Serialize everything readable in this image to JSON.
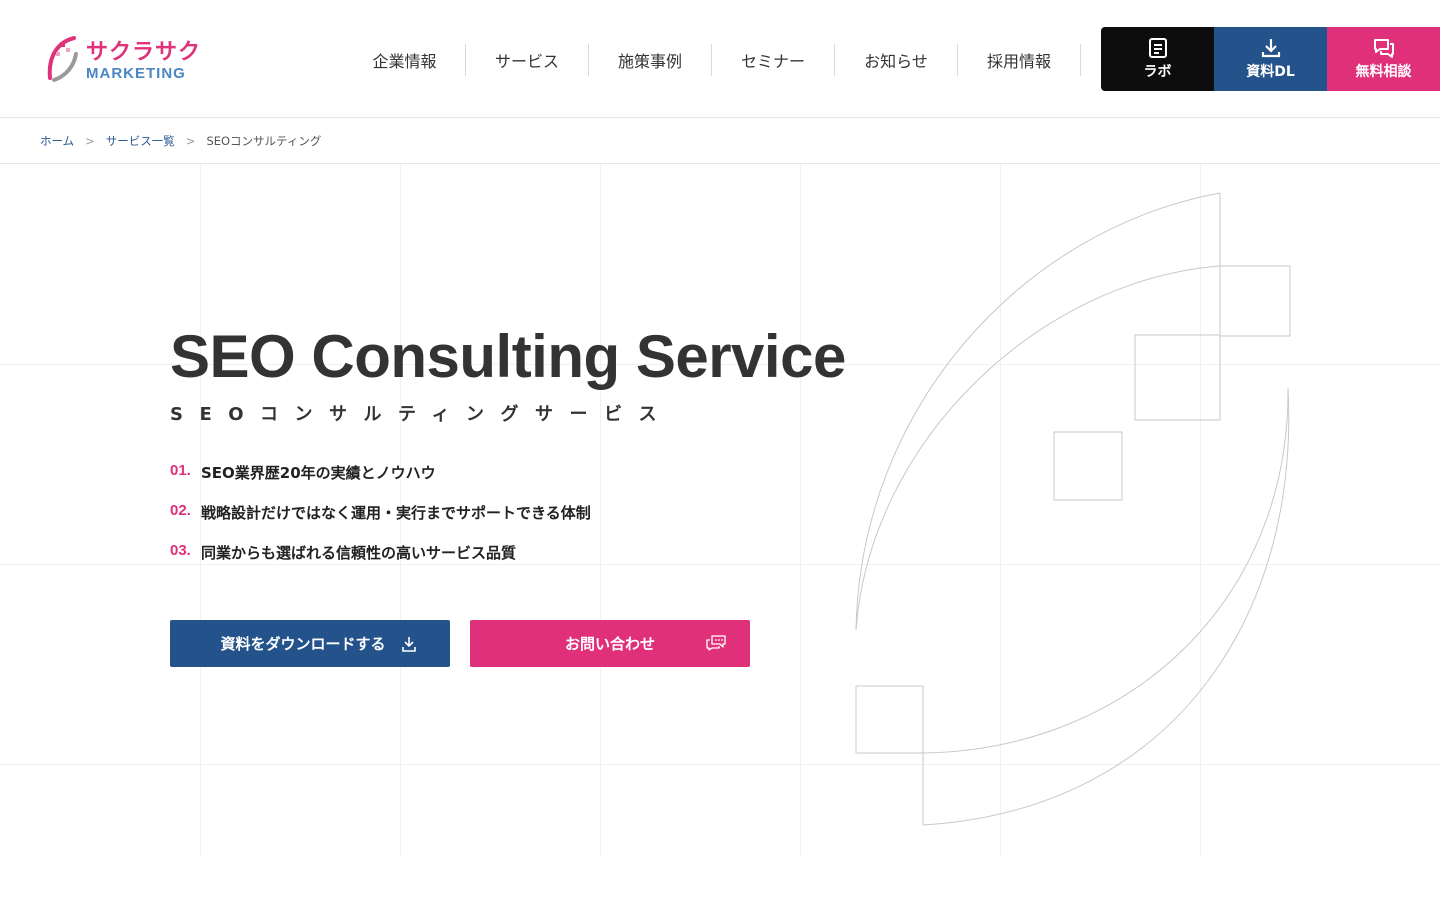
{
  "logo": {
    "jp": "サクラサク",
    "en": "MARKETING",
    "brand_pink": "#e0327a",
    "brand_blue": "#4a87c4"
  },
  "nav": {
    "items": [
      "企業情報",
      "サービス",
      "施策事例",
      "セミナー",
      "お知らせ",
      "採用情報"
    ]
  },
  "header_buttons": {
    "lab": {
      "label": "ラボ",
      "icon": "document-icon",
      "color": "#0d0d0d"
    },
    "download": {
      "label": "資料DL",
      "icon": "download-icon",
      "color": "#24528a"
    },
    "consult": {
      "label": "無料相談",
      "icon": "chat-icon",
      "color": "#e0307a"
    }
  },
  "breadcrumb": {
    "home": "ホーム",
    "sep1": ">",
    "services": "サービス一覧",
    "sep2": ">",
    "current": "SEOコンサルティング"
  },
  "hero": {
    "title": "SEO Consulting Service",
    "subtitle": "SEOコンサルティングサービス",
    "points": [
      {
        "num": "01.",
        "text": "SEO業界歴20年の実績とノウハウ"
      },
      {
        "num": "02.",
        "text": "戦略設計だけではなく運用・実行までサポートできる体制"
      },
      {
        "num": "03.",
        "text": "同業からも選ばれる信頼性の高いサービス品質"
      }
    ],
    "cta_download": {
      "label": "資料をダウンロードする",
      "icon": "download-arrow-icon"
    },
    "cta_contact": {
      "label": "お問い合わせ",
      "icon": "chat-bubble-icon"
    }
  }
}
